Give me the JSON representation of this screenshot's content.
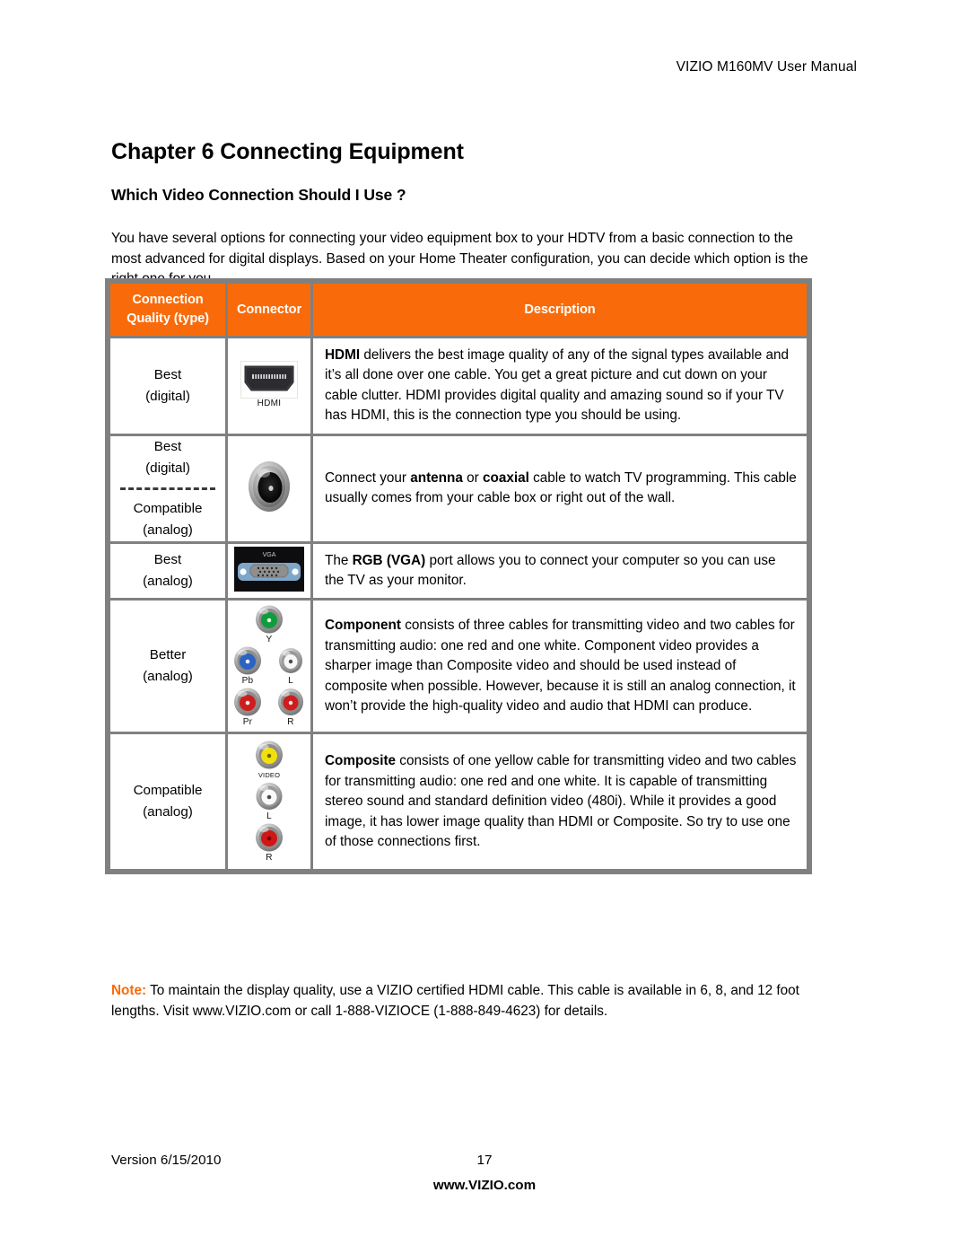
{
  "page": {
    "running_header": "VIZIO M160MV User Manual",
    "chapter_title": "Chapter 6 Connecting Equipment",
    "section_title": "Which Video Connection Should I Use ?",
    "intro_paragraph": "You have several options for connecting your video equipment box to your HDTV from a basic connection to the most advanced for digital displays. Based on your Home Theater configuration, you can decide which option is the right one for you."
  },
  "colors": {
    "header_orange": "#F96B0A",
    "table_border_gray": "#808080",
    "note_label_orange": "#F96B0A"
  },
  "table": {
    "headers": {
      "quality": "Connection Quality (type)",
      "quality_line1": "Connection",
      "quality_line2": "Quality (type)",
      "connector": "Connector",
      "description": "Description"
    },
    "rows": [
      {
        "quality_lines": [
          "Best",
          "(digital)"
        ],
        "has_dashed_separator": false,
        "connector_type": "hdmi",
        "connector_labels": [
          "HDMI"
        ],
        "description_parts": [
          {
            "text": "HDMI",
            "bold": true
          },
          {
            "text": " delivers the best image quality of any of the signal types available and it’s all done over one cable. You get a great picture and cut down on your cable clutter. HDMI provides digital quality and amazing sound so if your TV has HDMI, this is the connection type you should be using.",
            "bold": false
          }
        ]
      },
      {
        "quality_lines": [
          "Best",
          "(digital)"
        ],
        "quality_lines_after": [
          "Compatible",
          "(analog)"
        ],
        "has_dashed_separator": true,
        "connector_type": "coax",
        "connector_labels": [],
        "description_parts": [
          {
            "text": "Connect your ",
            "bold": false
          },
          {
            "text": "antenna",
            "bold": true
          },
          {
            "text": " or ",
            "bold": false
          },
          {
            "text": "coaxial",
            "bold": true
          },
          {
            "text": " cable to watch TV programming. This cable usually comes from your cable box or right out of the wall.",
            "bold": false
          }
        ]
      },
      {
        "quality_lines": [
          "Best",
          "(analog)"
        ],
        "has_dashed_separator": false,
        "connector_type": "vga",
        "connector_labels": [
          "VGA"
        ],
        "description_parts": [
          {
            "text": "The ",
            "bold": false
          },
          {
            "text": "RGB (VGA)",
            "bold": true
          },
          {
            "text": " port allows you to connect your computer so you can use the TV as your monitor.",
            "bold": false
          }
        ]
      },
      {
        "quality_lines": [
          "Better",
          "(analog)"
        ],
        "has_dashed_separator": false,
        "connector_type": "component",
        "connector_labels": [
          "Y",
          "Pb",
          "L",
          "Pr",
          "R"
        ],
        "description_parts": [
          {
            "text": "Component",
            "bold": true
          },
          {
            "text": " consists of three cables for transmitting video and two cables for transmitting audio: one red and one white. Component video provides a sharper image than Composite video and should be used instead of composite when possible. However, because it is still an analog connection, it won’t provide the high-quality video and audio that HDMI can produce.",
            "bold": false
          }
        ]
      },
      {
        "quality_lines": [
          "Compatible",
          "(analog)"
        ],
        "has_dashed_separator": false,
        "connector_type": "composite",
        "connector_labels": [
          "VIDEO",
          "L",
          "R"
        ],
        "description_parts": [
          {
            "text": "Composite",
            "bold": true
          },
          {
            "text": " consists of one yellow cable for transmitting video and two cables for transmitting audio: one red and one white. It is capable of transmitting stereo sound and standard definition video (480i). While it provides a good image, it has lower image quality than HDMI or Composite. So try to use one of those connections first.",
            "bold": false
          }
        ]
      }
    ]
  },
  "note": {
    "label": "Note:",
    "text": " To maintain the display quality, use a VIZIO certified HDMI cable. This cable is available in 6, 8, and 12 foot lengths. Visit www.VIZIO.com or call 1-888-VIZIOCE (1-888-849-4623) for details."
  },
  "footer": {
    "version": "Version 6/15/2010",
    "page_number": "17",
    "website": "www.VIZIO.com"
  }
}
